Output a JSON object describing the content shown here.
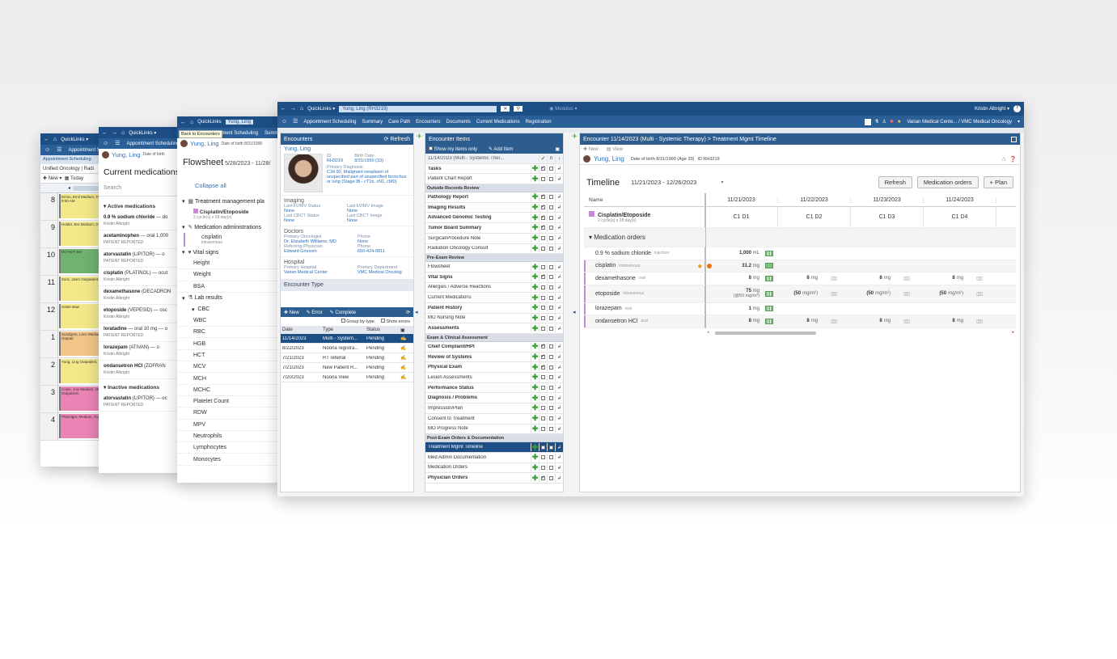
{
  "w1": {
    "tab_label": "Appointment Scheduling",
    "tab2": "Unified Oncology",
    "tab2b": "Radi",
    "new": "New",
    "today": "Today",
    "hours": [
      "8",
      "9",
      "10",
      "11",
      "12",
      "1",
      "2",
      "3",
      "4"
    ],
    "appts": [
      {
        "text": "Emos, Emil Medium, Fr - 9:00 AM",
        "color": "#f2e88a"
      },
      {
        "text": "Holder, Bra Medium, Ou",
        "color": "#f2e88a"
      },
      {
        "text": "DO NOT BO",
        "color": "#6fb36f"
      },
      {
        "text": "Zock, Jasm Outpatient,",
        "color": "#f2e88a"
      },
      {
        "text": "Sotter Baw",
        "color": "#f2e88a"
      },
      {
        "text": "Sundgren, Lenc Medium, Outpati",
        "color": "#f2c48a"
      },
      {
        "text": "Yung, Ling Outpatient,",
        "color": "#f2e88a"
      },
      {
        "text": "Coles, Josi Medium, Ou Outpatient,",
        "color": "#ea84b5"
      },
      {
        "text": "Pfanniger, Medium, Ou",
        "color": "#ea84b5"
      }
    ]
  },
  "w2": {
    "patient": "Yung, Ling",
    "dob_label": "Date of birth",
    "title": "Current medications",
    "search": "Search",
    "active_header": "Active medications",
    "meds": [
      {
        "name": "0.9 % sodium chloride",
        "rest": "— do",
        "by": "Kristin Albright"
      },
      {
        "name": "acetaminophen",
        "rest": "— oral 1,000",
        "by": "PATIENT REPORTED"
      },
      {
        "name": "atorvastatin",
        "rest": "(LIPITOR) — o",
        "by": "PATIENT REPORTED"
      },
      {
        "name": "cisplatin",
        "rest": "(PLATINOL) — ocut",
        "by": "Kristin Albright"
      },
      {
        "name": "dexamethasone",
        "rest": "(DECADRON",
        "by": "Kristin Albright"
      },
      {
        "name": "etoposide",
        "rest": "(VEPESID) — osc",
        "by": "Kristin Albright"
      },
      {
        "name": "loratadine",
        "rest": "— oral 10 mg — o",
        "by": "PATIENT REPORTED"
      },
      {
        "name": "lorazepam",
        "rest": "(ATIVAN) — o",
        "by": "Kristin Albright"
      },
      {
        "name": "ondansetron HCl",
        "rest": "(ZOFRAN",
        "by": "Kristin Albright"
      }
    ],
    "inactive_header": "Inactive medications",
    "inactive_meds": [
      {
        "name": "atorvastatin",
        "rest": "(LIPITOR) — oc",
        "by": "PATIENT REPORTED"
      }
    ]
  },
  "w3": {
    "quicklinks": "QuickLinks",
    "patient_tab": "Yung, Ling",
    "nav1": "Appointment Scheduling",
    "nav2": "Summ",
    "tooltip": "Back to Encounters",
    "patient": "Yung, Ling",
    "dob": "Date of birth 8/31/1990",
    "title": "Flowsheet",
    "range": "5/28/2023 - 11/28/",
    "collapse": "Collapse all",
    "tmp": "Treatment management pla",
    "regimen": "Cisplatin/Etoposide",
    "regimen_sub": "2 cycle(s) x 28 day(s)",
    "med_admin": "Medication administrations",
    "cisplatin": "cisplatin",
    "cisplatin_sub": "intravenous",
    "vitals": "Vital signs",
    "vital_items": [
      "Height",
      "Weight",
      "BSA"
    ],
    "labs": "Lab results",
    "cbc": "CBC",
    "lab_items": [
      "WBC",
      "RBC",
      "HGB",
      "HCT",
      "MCV",
      "MCH",
      "MCHC",
      "Platelet Count",
      "RDW",
      "MPV",
      "Neutrophils",
      "Lymphocytes",
      "Monocytes"
    ]
  },
  "w4": {
    "quicklinks": "QuickLinks",
    "patient_tab": "Yung, Ling (RH3219)",
    "center_tag": "Modulus",
    "user": "Kristin Albright",
    "nav": [
      "Appointment Scheduling",
      "Summary",
      "Care Path",
      "Encounters",
      "Documents",
      "Current Medications",
      "Registration"
    ],
    "org": "Varian Medical Cente... / VMC Medical Oncology",
    "encounters": {
      "title": "Encounters",
      "refresh": "Refresh",
      "patient": "Yung, Ling",
      "id_label": "ID",
      "id": "RH3219",
      "birth_label": "Birth Date",
      "birth": "8/31/1990 (33)",
      "dx_label": "Primary Diagnosis",
      "dx": "C34.90, Malignant neoplasm of unspecified part of unspecified bronchus or lung (Stage IB - cT1b, cN1, cM0)",
      "imaging": "Imaging",
      "kv_label": "Last kV/MV Status",
      "kv_val": "None",
      "kvi_label": "Last kV/MV Image",
      "kvi_val": "None",
      "cbct_label": "Last CBCT Status",
      "cbct_val": "None",
      "cbcti_label": "Last CBCT Image",
      "cbcti_val": "None",
      "doctors": "Doctors",
      "po_label": "Primary Oncologist",
      "po": "Dr. Elizabeth Williams, MD",
      "phone_label": "Phone",
      "phone1": "None",
      "ref_label": "Referring Physician",
      "ref": "Edward Grissom",
      "phone2": "650-424-9811",
      "hospital": "Hospital",
      "ph_label": "Primary Hospital",
      "ph": "Varian Medical Center",
      "pd_label": "Primary Department",
      "pd": "VMC Medical Oncolog",
      "enc_type": "Encounter Type",
      "new": "New",
      "error": "Error",
      "complete": "Complete",
      "group": "Group by type",
      "show_errors": "Show errors",
      "cols": [
        "Date",
        "Type",
        "Status"
      ],
      "rows": [
        [
          "11/14/2023",
          "Multi - System...",
          "Pending"
        ],
        [
          "8/22/2023",
          "Noona registra...",
          "Pending"
        ],
        [
          "7/21/2023",
          "RT referral",
          "Pending"
        ],
        [
          "7/21/2023",
          "New Patient R...",
          "Pending"
        ],
        [
          "7/20/2023",
          "Noona View",
          "Pending"
        ]
      ]
    },
    "items": {
      "title": "Encounter Items",
      "show_mine": "Show my items only",
      "add_item": "Add Item",
      "enc_row": "11/14/2023 (Multi - Systemic Ther...",
      "sections": [
        {
          "title": "",
          "items": [
            {
              "n": "Tasks",
              "b": true
            },
            {
              "n": "Patient Chart Report",
              "b": false
            }
          ]
        },
        {
          "title": "Outside Records Review",
          "items": [
            {
              "n": "Pathology Report",
              "b": true
            },
            {
              "n": "Imaging Results",
              "b": true
            },
            {
              "n": "Advanced Genomic Testing",
              "b": true
            },
            {
              "n": "Tumor Board Summary",
              "b": true
            },
            {
              "n": "Surgical/Procedure Note",
              "b": false
            },
            {
              "n": "Radiation Oncology Consult",
              "b": false
            }
          ]
        },
        {
          "title": "Pre-Exam Review",
          "items": [
            {
              "n": "Flowsheet",
              "b": false
            },
            {
              "n": "Vital Signs",
              "b": true
            },
            {
              "n": "Allergies / Adverse Reactions",
              "b": false
            },
            {
              "n": "Current Medications",
              "b": false
            },
            {
              "n": "Patient History",
              "b": true
            },
            {
              "n": "MO Nursing Note",
              "b": false
            },
            {
              "n": "Assessments",
              "b": true
            }
          ]
        },
        {
          "title": "Exam & Clinical Assessment",
          "items": [
            {
              "n": "Chief Complaint/HPI",
              "b": true
            },
            {
              "n": "Review of Systems",
              "b": true
            },
            {
              "n": "Physical Exam",
              "b": true
            },
            {
              "n": "Lesion Assessments",
              "b": false
            },
            {
              "n": "Performance Status",
              "b": true
            },
            {
              "n": "Diagnosis / Problems",
              "b": true
            },
            {
              "n": "Impression/Plan",
              "b": false
            },
            {
              "n": "Consent to Treatment",
              "b": false
            },
            {
              "n": "MO Progress Note",
              "b": false
            }
          ]
        },
        {
          "title": "Post-Exam Orders & Documentation",
          "items": [
            {
              "n": "Treatment Mgmt Timeline",
              "b": false,
              "sel": true
            },
            {
              "n": "Med Admin Documentation",
              "b": false
            },
            {
              "n": "Medication Orders",
              "b": false
            },
            {
              "n": "Physician Orders",
              "b": true
            }
          ]
        }
      ]
    },
    "timeline": {
      "breadcrumb": "Encounter 11/14/2023 (Multi - Systemic Therapy) > Treatment Mgmt Timeline",
      "new": "New",
      "view": "View",
      "patient": "Yung, Ling",
      "dob": "Date of birth 8/31/1990 (Age 33)",
      "id": "ID RH3219",
      "title": "Timeline",
      "range": "11/21/2023 - 12/26/2023",
      "refresh": "Refresh",
      "med_orders_btn": "Medication orders",
      "plan_btn": "+ Plan",
      "name_col": "Name",
      "dates": [
        "11/21/2023",
        "11/22/2023",
        "11/23/2023",
        "11/24/2023"
      ],
      "regimen": "Cisplatin/Etoposide",
      "regimen_sub": "2 cycle(s) x 28 day(s)",
      "cycles": [
        "C1 D1",
        "C1 D2",
        "C1 D3",
        "C1 D4"
      ],
      "med_header": "Medication orders",
      "meds": [
        {
          "name": "0.9 % sodium chloride",
          "route": "injection",
          "d1": "1,000",
          "u1": "mL",
          "others": []
        },
        {
          "name": "cisplatin",
          "route": "intravenous",
          "d1": "31.2",
          "u1": "mg",
          "others": []
        },
        {
          "name": "dexamethasone",
          "route": "oral",
          "d1": "8",
          "u1": "mg",
          "others": [
            "8",
            "8",
            "8"
          ],
          "ou": "mg"
        },
        {
          "name": "etoposide",
          "route": "intravenous",
          "d1": "75",
          "u1": "mg",
          "sub": "(@50 mg/m²)",
          "others": [
            "(50",
            "(50",
            "(50"
          ],
          "ou": "mg/m²)"
        },
        {
          "name": "lorazepam",
          "route": "oral",
          "d1": "1",
          "u1": "mg",
          "others": []
        },
        {
          "name": "ondansetron HCl",
          "route": "oral",
          "d1": "8",
          "u1": "mg",
          "others": [
            "8",
            "8",
            "8"
          ],
          "ou": "mg"
        }
      ]
    }
  }
}
